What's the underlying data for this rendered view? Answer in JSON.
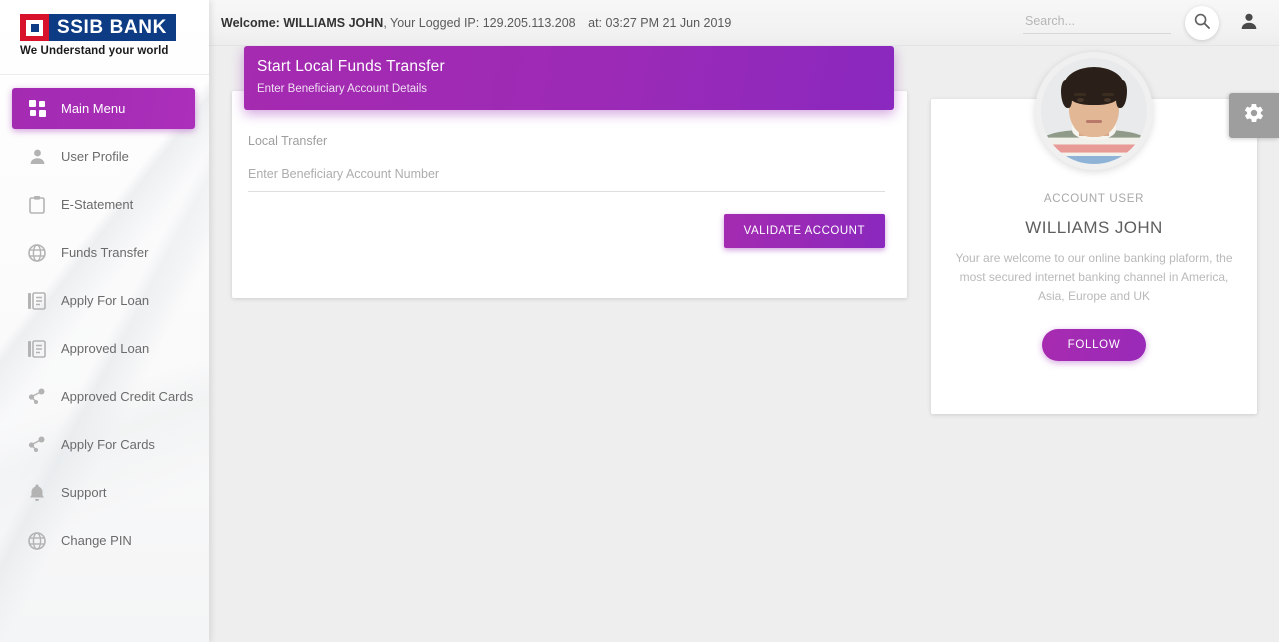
{
  "brand": {
    "mark_icon": "square-logo-icon",
    "name": "SSIB BANK",
    "tagline": "We Understand your world",
    "logo_red": "#d8122a",
    "logo_blue": "#0d3c84"
  },
  "accent": {
    "purple_start": "#a52bb0",
    "purple_end": "#8a28bf",
    "page_bg": "#eeeeee"
  },
  "header": {
    "welcome_prefix": "Welcome:",
    "user_name": "WILLIAMS JOHN",
    "ip_label": ", Your Logged IP:",
    "ip_value": "129.205.113.208",
    "time_label": "at:",
    "time_value": "03:27 PM 21 Jun 2019",
    "search_placeholder": "Search...",
    "search_value": "",
    "search_icon": "search-icon",
    "account_icon": "person-icon"
  },
  "sidebar": {
    "items": [
      {
        "label": "Main Menu",
        "icon": "grid-icon",
        "active": true
      },
      {
        "label": "User Profile",
        "icon": "person-icon",
        "active": false
      },
      {
        "label": "E-Statement",
        "icon": "clipboard-icon",
        "active": false
      },
      {
        "label": "Funds Transfer",
        "icon": "globe-icon",
        "active": false
      },
      {
        "label": "Apply For Loan",
        "icon": "documents-icon",
        "active": false
      },
      {
        "label": "Approved Loan",
        "icon": "documents-icon",
        "active": false
      },
      {
        "label": "Approved Credit Cards",
        "icon": "share-nodes-icon",
        "active": false
      },
      {
        "label": "Apply For Cards",
        "icon": "share-nodes-icon",
        "active": false
      },
      {
        "label": "Support",
        "icon": "bell-icon",
        "active": false
      },
      {
        "label": "Change PIN",
        "icon": "globe-icon",
        "active": false
      }
    ]
  },
  "transfer": {
    "title": "Start Local Funds Transfer",
    "subtitle": "Enter Beneficiary Account Details",
    "type_label": "Local Transfer",
    "account_placeholder": "Enter Beneficiary Account Number",
    "account_value": "",
    "validate_button": "VALIDATE ACCOUNT"
  },
  "profile": {
    "avatar_icon": "user-photo-avatar",
    "role": "ACCOUNT USER",
    "name": "WILLIAMS JOHN",
    "description": "Your are welcome to our online banking plaform, the most secured internet banking channel in America, Asia, Europe and UK",
    "follow_button": "FOLLOW"
  },
  "settings": {
    "icon": "gear-icon"
  }
}
